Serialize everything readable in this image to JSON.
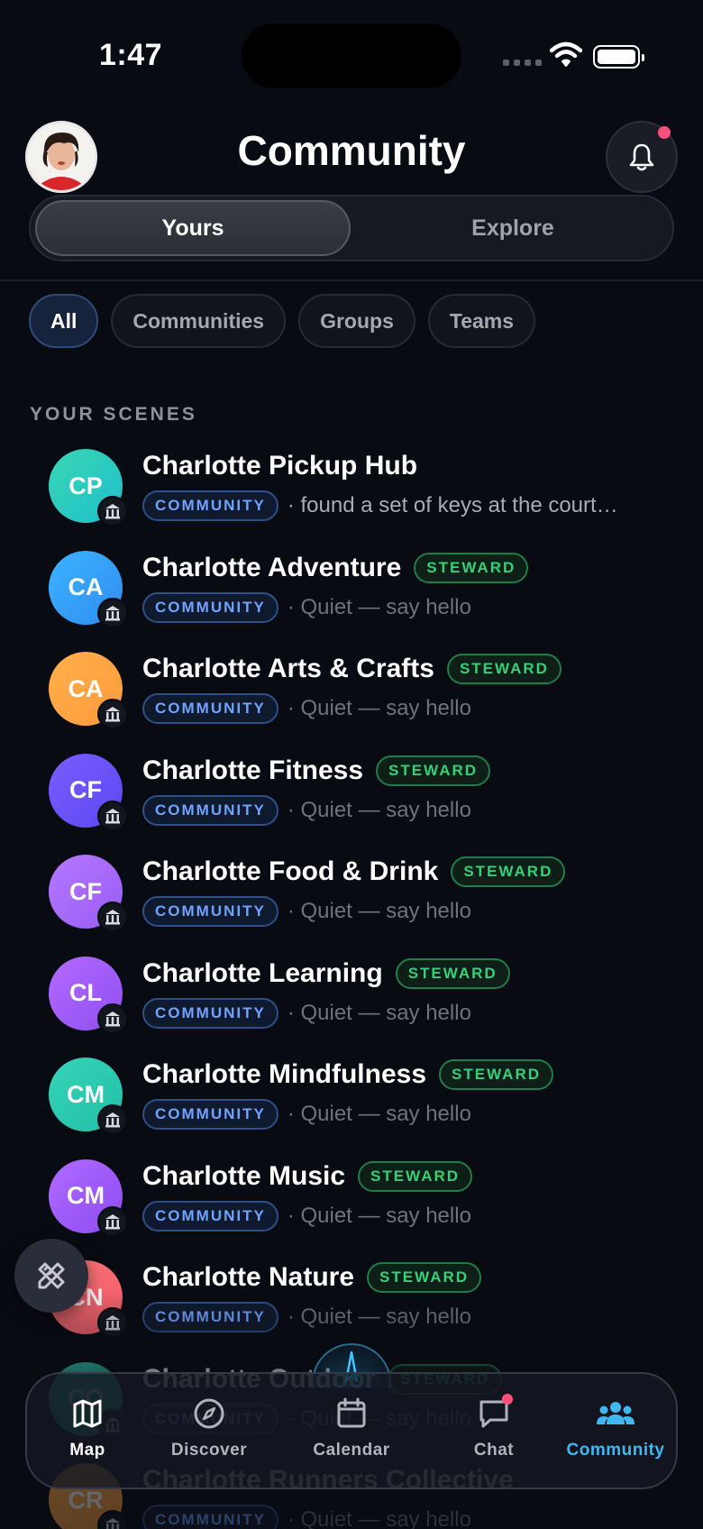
{
  "status": {
    "time": "1:47"
  },
  "header": {
    "title": "Community"
  },
  "segments": {
    "yours": "Yours",
    "explore": "Explore"
  },
  "filters": [
    "All",
    "Communities",
    "Groups",
    "Teams"
  ],
  "section": {
    "title": "YOUR SCENES"
  },
  "scenes": [
    {
      "initials": "CP",
      "name": "Charlotte Pickup Hub",
      "type": "COMMUNITY",
      "message": "· found a set of keys at the court…",
      "steward": "",
      "color1": "#39d6b0",
      "color2": "#1fbfcf"
    },
    {
      "initials": "CA",
      "name": "Charlotte Adventure",
      "type": "COMMUNITY",
      "message": "· Quiet — say hello",
      "steward": "STEWARD",
      "color1": "#3bb4ff",
      "color2": "#2f8cf0"
    },
    {
      "initials": "CA",
      "name": "Charlotte Arts & Crafts",
      "type": "COMMUNITY",
      "message": "· Quiet — say hello",
      "steward": "STEWARD",
      "color1": "#ffb04a",
      "color2": "#ff9a3c"
    },
    {
      "initials": "CF",
      "name": "Charlotte Fitness",
      "type": "COMMUNITY",
      "message": "· Quiet — say hello",
      "steward": "STEWARD",
      "color1": "#7b5cff",
      "color2": "#5a48f0"
    },
    {
      "initials": "CF",
      "name": "Charlotte Food & Drink",
      "type": "COMMUNITY",
      "message": "· Quiet — say hello",
      "steward": "STEWARD",
      "color1": "#b478ff",
      "color2": "#9a5cf5"
    },
    {
      "initials": "CL",
      "name": "Charlotte Learning",
      "type": "COMMUNITY",
      "message": "· Quiet — say hello",
      "steward": "STEWARD",
      "color1": "#b36bff",
      "color2": "#8f4ef0"
    },
    {
      "initials": "CM",
      "name": "Charlotte Mindfulness",
      "type": "COMMUNITY",
      "message": "· Quiet — say hello",
      "steward": "STEWARD",
      "color1": "#35d4b8",
      "color2": "#22bfa6"
    },
    {
      "initials": "CM",
      "name": "Charlotte Music",
      "type": "COMMUNITY",
      "message": "· Quiet — say hello",
      "steward": "STEWARD",
      "color1": "#b06bff",
      "color2": "#8d4bf2"
    },
    {
      "initials": "CN",
      "name": "Charlotte Nature",
      "type": "COMMUNITY",
      "message": "· Quiet — say hello",
      "steward": "STEWARD",
      "color1": "#ff7a7a",
      "color2": "#f25a6a"
    },
    {
      "initials": "CO",
      "name": "Charlotte Outdoor",
      "type": "COMMUNITY",
      "message": "· Quiet — say hello",
      "steward": "STEWARD",
      "color1": "#35d4b8",
      "color2": "#22bfa6"
    },
    {
      "initials": "CR",
      "name": "Charlotte Runners Collective",
      "type": "COMMUNITY",
      "message": "· Quiet — say hello",
      "steward": "",
      "color1": "#ffb04a",
      "color2": "#ff9a3c"
    }
  ],
  "tabs": {
    "map": "Map",
    "discover": "Discover",
    "calendar": "Calendar",
    "chat": "Chat",
    "community": "Community"
  },
  "colors": {
    "accent": "#3fb8f0",
    "steward": "#35d07a",
    "type": "#6fa3ff",
    "notification": "#ff4f7b"
  }
}
